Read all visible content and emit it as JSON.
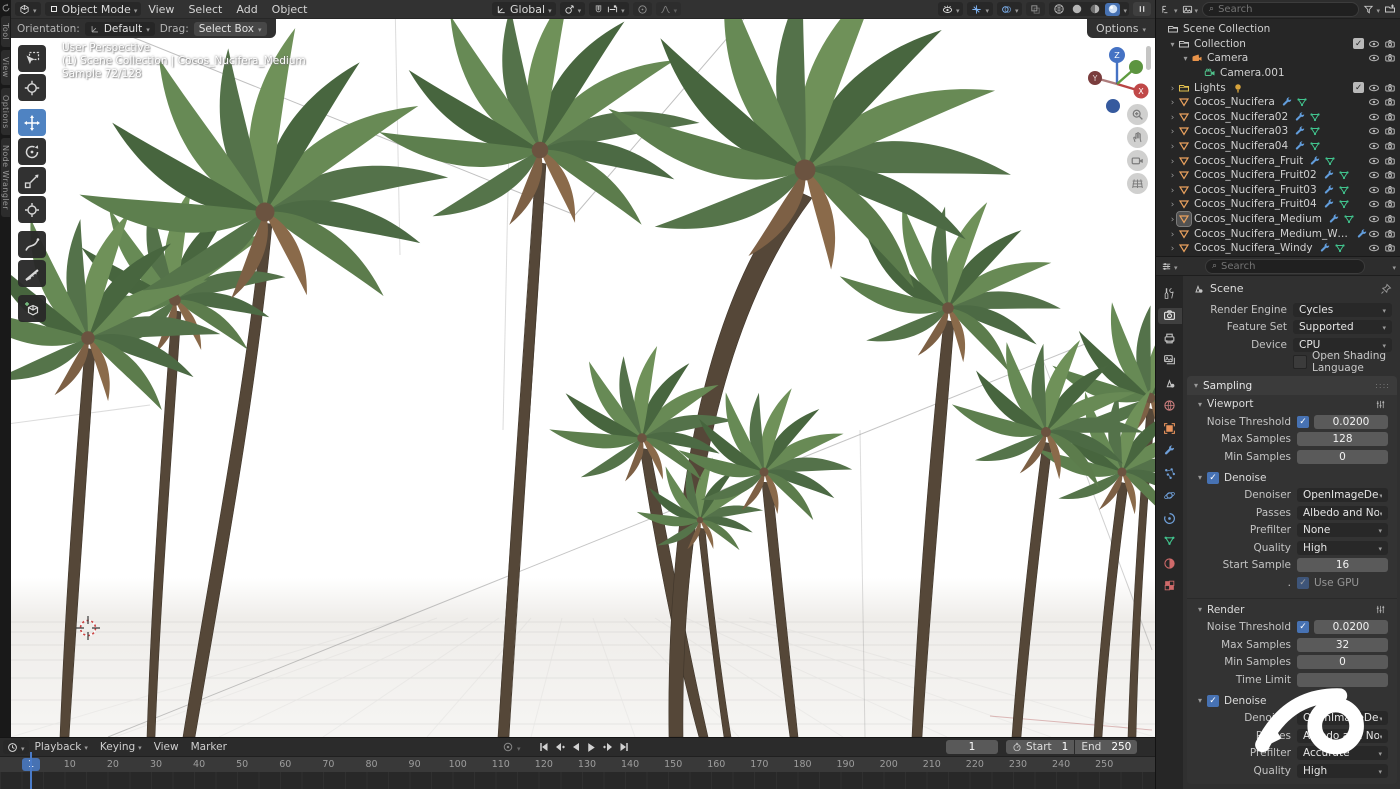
{
  "header": {
    "mode": "Object Mode",
    "menus": [
      "View",
      "Select",
      "Add",
      "Object"
    ],
    "orientation": "Global",
    "tool_settings": {
      "orientation_label": "Orientation:",
      "orientation_value": "Default",
      "drag_label": "Drag:",
      "drag_value": "Select Box",
      "options": "Options"
    }
  },
  "left_tabs": [
    "Tool",
    "View",
    "Options",
    "Node Wrangler"
  ],
  "viewport": {
    "overlay_line1": "User Perspective",
    "overlay_line2": "(1) Scene Collection | Cocos_Nucifera_Medium",
    "overlay_line3": "Sample 72/128",
    "gizmo": {
      "x": "X",
      "y": "Y",
      "z": "Z"
    }
  },
  "outliner": {
    "search_placeholder": "Search",
    "rows": [
      {
        "label": "Scene Collection"
      },
      {
        "label": "Collection"
      },
      {
        "label": "Camera"
      },
      {
        "label": "Camera.001"
      },
      {
        "label": "Lights"
      },
      {
        "label": "Cocos_Nucifera"
      },
      {
        "label": "Cocos_Nucifera02"
      },
      {
        "label": "Cocos_Nucifera03"
      },
      {
        "label": "Cocos_Nucifera04"
      },
      {
        "label": "Cocos_Nucifera_Fruit"
      },
      {
        "label": "Cocos_Nucifera_Fruit02"
      },
      {
        "label": "Cocos_Nucifera_Fruit03"
      },
      {
        "label": "Cocos_Nucifera_Fruit04"
      },
      {
        "label": "Cocos_Nucifera_Medium",
        "selected": true
      },
      {
        "label": "Cocos_Nucifera_Medium_Windy"
      },
      {
        "label": "Cocos_Nucifera_Windy"
      }
    ]
  },
  "properties": {
    "search_placeholder": "Search",
    "breadcrumb": "Scene",
    "render_engine_label": "Render Engine",
    "render_engine": "Cycles",
    "feature_set_label": "Feature Set",
    "feature_set": "Supported",
    "device_label": "Device",
    "device": "CPU",
    "osl_label": "Open Shading Language",
    "sampling_title": "Sampling",
    "viewport_section": {
      "title": "Viewport",
      "noise_label": "Noise Threshold",
      "noise": "0.0200",
      "max_label": "Max Samples",
      "max": "128",
      "min_label": "Min Samples",
      "min": "0",
      "denoise_title": "Denoise",
      "denoiser_label": "Denoiser",
      "denoiser": "OpenImageDenoise",
      "passes_label": "Passes",
      "passes": "Albedo and Normal",
      "prefilter_label": "Prefilter",
      "prefilter": "None",
      "quality_label": "Quality",
      "quality": "High",
      "start_label": "Start Sample",
      "start": "16",
      "gpu_label": "Use GPU"
    },
    "render_section": {
      "title": "Render",
      "noise_label": "Noise Threshold",
      "noise": "0.0200",
      "max_label": "Max Samples",
      "max": "32",
      "min_label": "Min Samples",
      "min": "0",
      "time_label": "Time Limit",
      "denoise_title": "Denoise",
      "denoiser_label": "Denoiser",
      "denoiser": "OpenImageDenoise",
      "passes_label": "Passes",
      "passes": "Albedo and Normal",
      "prefilter_label": "Prefilter",
      "prefilter": "Accurate",
      "quality_label": "Quality",
      "quality": "High"
    }
  },
  "timeline": {
    "menus": [
      "Playback",
      "Keying",
      "View",
      "Marker"
    ],
    "current_frame": "1",
    "start_label": "Start",
    "start_value": "1",
    "end_label": "End",
    "end_value": "250",
    "ticks": [
      1,
      10,
      20,
      30,
      40,
      50,
      60,
      70,
      80,
      90,
      100,
      110,
      120,
      130,
      140,
      150,
      160,
      170,
      180,
      190,
      200,
      210,
      220,
      230,
      240,
      250
    ],
    "playhead_frame": 1
  },
  "colors": {
    "accent": "#4772b3",
    "active_tool": "#5680c2",
    "mesh_icon": "#e9a15e",
    "modifier_icon": "#629ddb",
    "mesh_data_icon": "#41c48e"
  }
}
